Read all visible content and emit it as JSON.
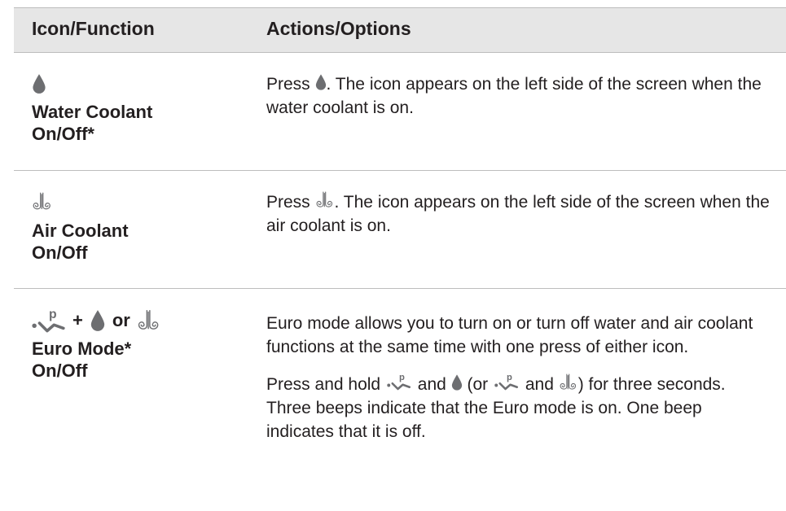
{
  "header": {
    "col1": "Icon/Function",
    "col2": "Actions/Options"
  },
  "rows": [
    {
      "icon": "water-drop-icon",
      "name_line1": "Water Coolant",
      "name_line2": "On/Off*",
      "text_before": "Press ",
      "text_after": ". The icon appears on the left side of the screen when the water coolant is on."
    },
    {
      "icon": "air-coolant-icon",
      "name_line1": "Air Coolant",
      "name_line2": "On/Off",
      "text_before": "Press ",
      "text_after": ". The icon appears on the left side of the screen when the air coolant is on."
    },
    {
      "icon": "euro-mode-icon",
      "plus": "+",
      "or": "or",
      "name_line1": "Euro Mode*",
      "name_line2": "On/Off",
      "para1": "Euro mode allows you to turn on or turn off water and air coolant functions at the same time with one press of either icon.",
      "p2_a": "Press and hold ",
      "p2_b": " and ",
      "p2_c": " (or ",
      "p2_d": " and ",
      "p2_e": ") for three seconds. Three beeps indicate that the Euro mode is on. One beep indicates that it is off."
    }
  ],
  "colors": {
    "header_bg": "#e6e6e6",
    "divider": "#bdbdbd",
    "icon_gray": "#6d6e71",
    "text": "#231f20"
  }
}
